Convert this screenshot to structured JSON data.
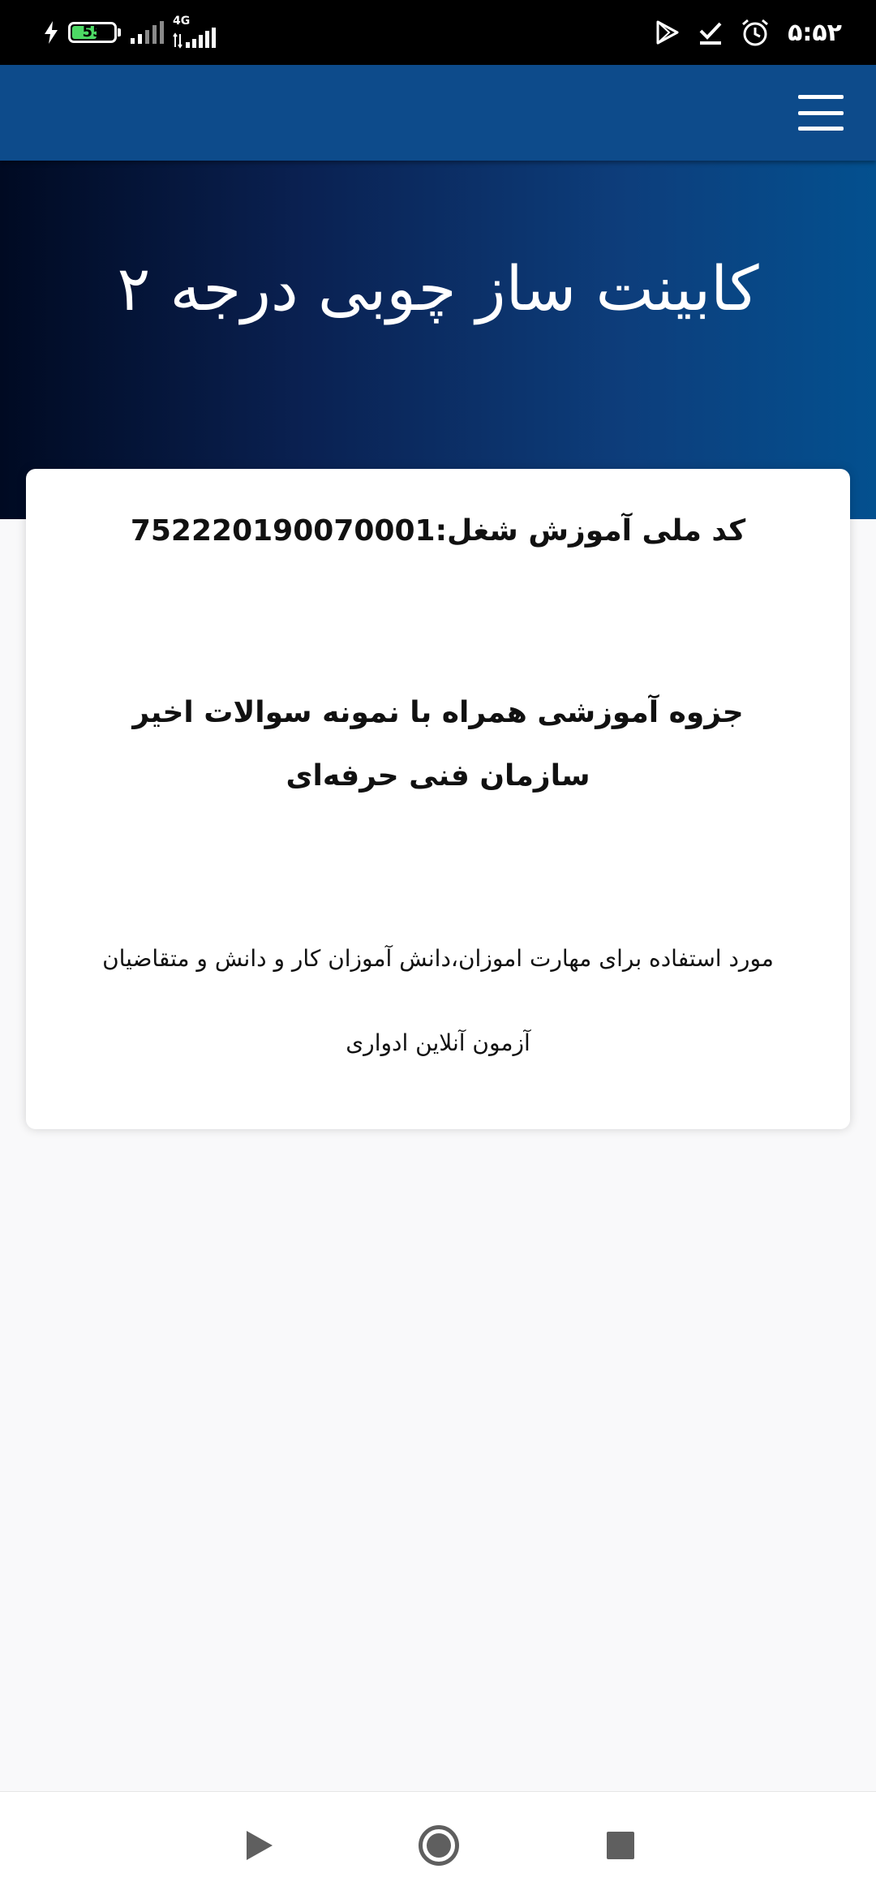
{
  "status_bar": {
    "battery_level": "55",
    "network_type": "4G",
    "time": "۵:۵۲",
    "icons": [
      "charging-bolt-icon",
      "battery-icon",
      "signal-icon",
      "signal-4g-icon",
      "play-store-icon",
      "check-download-icon",
      "alarm-icon"
    ]
  },
  "app_bar": {
    "menu_icon": "hamburger-menu-icon"
  },
  "hero": {
    "title": "کابینت ساز چوبی درجه ۲"
  },
  "card": {
    "code_line": "کد ملی آموزش شغل:752220190070001",
    "booklet_line": "جزوه آموزشی همراه با نمونه سوالات اخیر سازمان فنی حرفه‌ای",
    "usage_line": "مورد استفاده برای مهارت اموزان،دانش آموزان کار و دانش و متقاضیان آزمون آنلاین ادواری"
  },
  "nav_bar": {
    "icons": [
      "back-triangle-icon",
      "home-circle-icon",
      "recents-square-icon"
    ]
  },
  "colors": {
    "app_bar": "#0d4b8b",
    "hero_gradient_start": "#000a22",
    "hero_gradient_end": "#03508f",
    "page_background": "#f9f9fa",
    "card_background": "#ffffff",
    "battery_fill": "#4cd964",
    "nav_icon": "#5f5f5f"
  }
}
